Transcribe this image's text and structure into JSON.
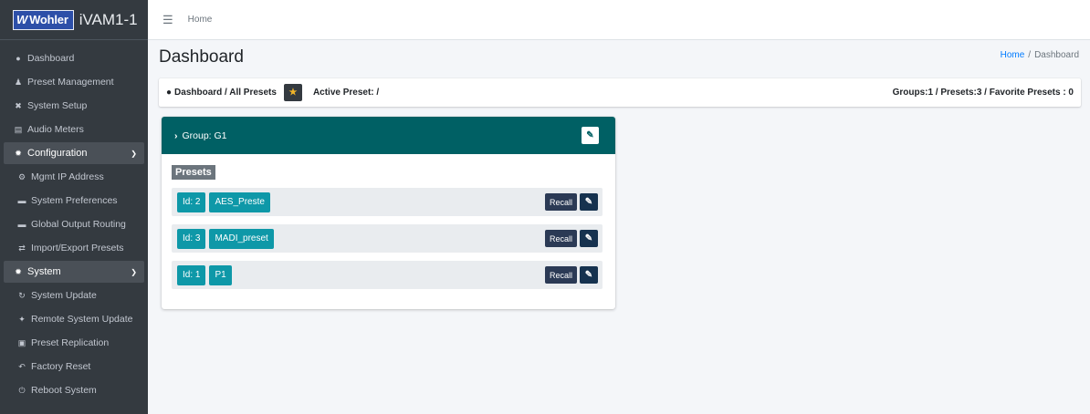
{
  "brand": {
    "logo": "Wohler",
    "name": "iVAM1-1"
  },
  "sidebar": {
    "items": [
      {
        "label": "Dashboard",
        "icon": "tachometer-icon"
      },
      {
        "label": "Preset Management",
        "icon": "users-icon"
      },
      {
        "label": "System Setup",
        "icon": "tools-icon"
      },
      {
        "label": "Audio Meters",
        "icon": "bar-chart-icon"
      },
      {
        "label": "Configuration",
        "icon": "gear-icon"
      },
      {
        "label": "Mgmt IP Address",
        "icon": "network-icon"
      },
      {
        "label": "System Preferences",
        "icon": "keyboard-icon"
      },
      {
        "label": "Global Output Routing",
        "icon": "keyboard-icon"
      },
      {
        "label": "Import/Export Presets",
        "icon": "exchange-icon"
      },
      {
        "label": "System",
        "icon": "gears-icon"
      },
      {
        "label": "System Update",
        "icon": "sync-icon"
      },
      {
        "label": "Remote System Update",
        "icon": "satellite-icon"
      },
      {
        "label": "Preset Replication",
        "icon": "copy-icon"
      },
      {
        "label": "Factory Reset",
        "icon": "undo-icon"
      },
      {
        "label": "Reboot System",
        "icon": "power-icon"
      }
    ]
  },
  "topbar": {
    "home": "Home"
  },
  "page": {
    "title": "Dashboard"
  },
  "breadcrumb": {
    "home": "Home",
    "sep": "/",
    "current": "Dashboard"
  },
  "summary": {
    "path": "Dashboard / All Presets",
    "active_preset": "Active Preset: /",
    "stats": "Groups:1 / Presets:3 / Favorite Presets : 0"
  },
  "group": {
    "title": "Group: G1",
    "presets_label": "Presets",
    "presets": [
      {
        "id": "Id: 2",
        "name": "AES_Preste",
        "recall": "Recall"
      },
      {
        "id": "Id: 3",
        "name": "MADI_preset",
        "recall": "Recall"
      },
      {
        "id": "Id: 1",
        "name": "P1",
        "recall": "Recall"
      }
    ]
  },
  "colors": {
    "sidebar_bg": "#343a40",
    "group_header": "#006064",
    "tag_bg": "#0e98a8",
    "link": "#007bff"
  }
}
